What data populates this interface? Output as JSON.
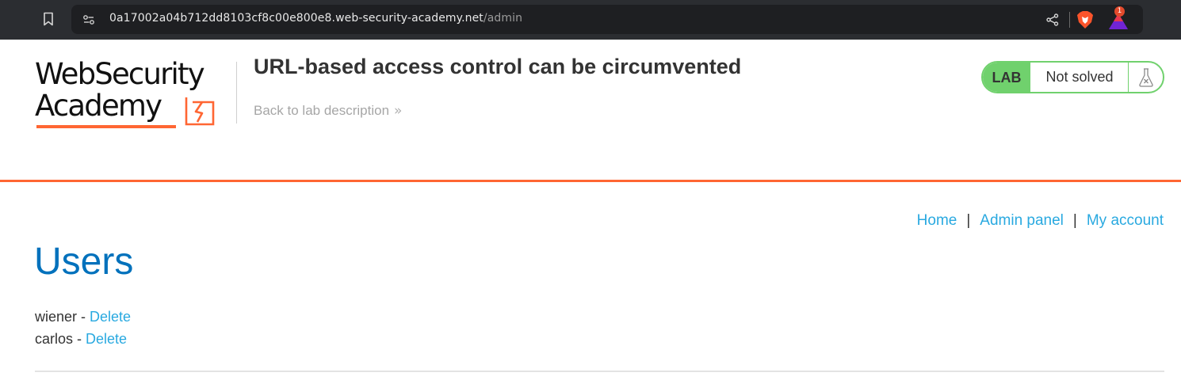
{
  "browser": {
    "url_host": "0a17002a04b712dd8103cf8c00e800e8.web-security-academy.net",
    "url_path": "/admin",
    "notifications_badge": "1",
    "icons": [
      "bookmark-icon",
      "site-info-icon",
      "share-icon",
      "brave-shield-icon",
      "brave-rewards-icon"
    ]
  },
  "header": {
    "logo_line1": "WebSecurity",
    "logo_line2": "Academy",
    "lab_title": "URL-based access control can be circumvented",
    "back_link": "Back to lab description",
    "back_chevron": "»",
    "lab_badge": "LAB",
    "lab_status": "Not solved",
    "accent_color": "#ff6633",
    "status_color": "#70d16d"
  },
  "nav": {
    "items": [
      {
        "label": "Home"
      },
      {
        "label": "Admin panel"
      },
      {
        "label": "My account"
      }
    ],
    "separator": "|"
  },
  "main": {
    "title": "Users",
    "users": [
      {
        "name": "wiener",
        "separator": " - ",
        "action": "Delete"
      },
      {
        "name": "carlos",
        "separator": " - ",
        "action": "Delete"
      }
    ]
  }
}
